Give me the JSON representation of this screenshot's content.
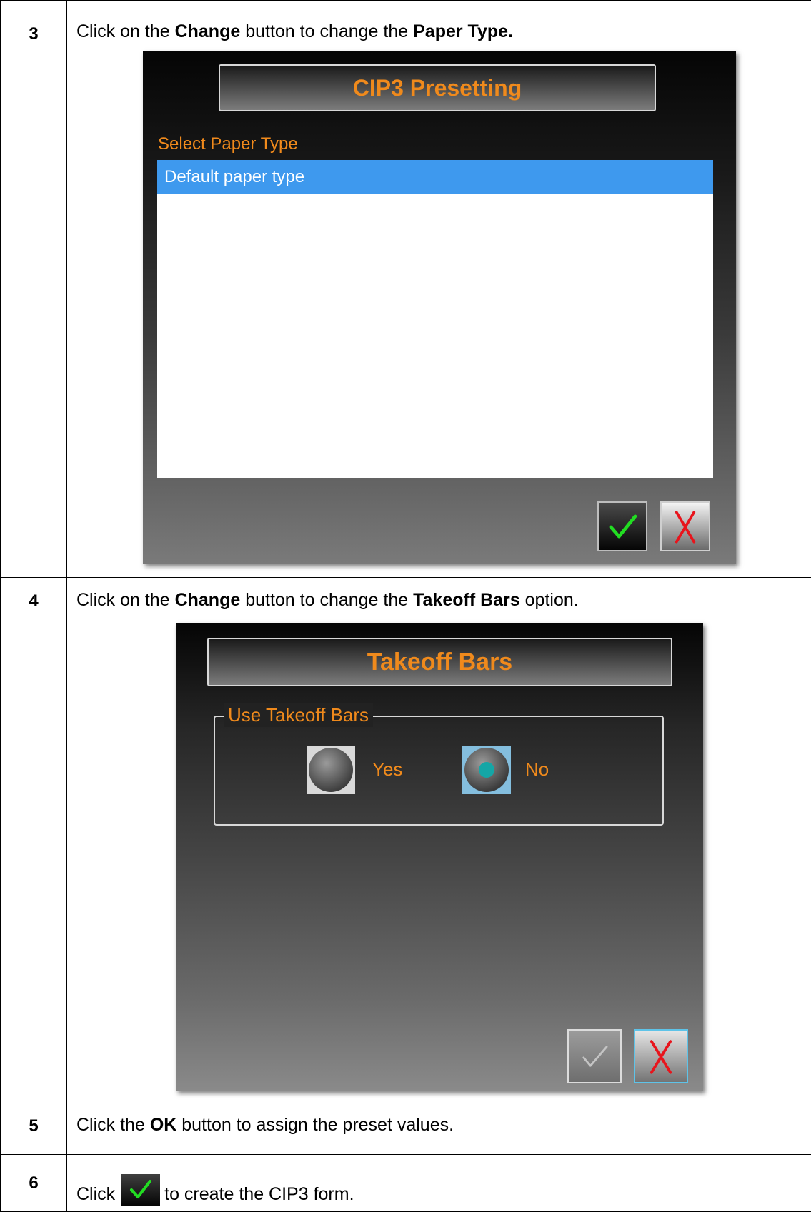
{
  "steps": [
    {
      "number": "3",
      "text_parts": [
        "Click on the ",
        "Change",
        " button to change the ",
        "Paper Type."
      ]
    },
    {
      "number": "4",
      "text_parts": [
        "Click on the ",
        "Change",
        " button to change the ",
        "Takeoff Bars",
        " option."
      ]
    },
    {
      "number": "5",
      "text_parts": [
        "Click the ",
        "OK",
        " button to assign the preset values."
      ]
    },
    {
      "number": "6",
      "text_parts": [
        "Click",
        "to create the CIP3 form."
      ]
    }
  ],
  "dialog_cip3": {
    "title": "CIP3 Presetting",
    "section_label": "Select Paper Type",
    "selected_item": "Default paper type"
  },
  "dialog_takeoff": {
    "title": "Takeoff Bars",
    "group_label": "Use Takeoff Bars",
    "option_yes": "Yes",
    "option_no": "No",
    "selected_option": "No"
  },
  "icons": {
    "ok": "checkmark-icon",
    "cancel": "x-icon"
  },
  "colors": {
    "accent_orange": "#f08a1c",
    "selection_blue": "#3e99ee",
    "check_green": "#22dd22",
    "x_red": "#e8141c"
  }
}
